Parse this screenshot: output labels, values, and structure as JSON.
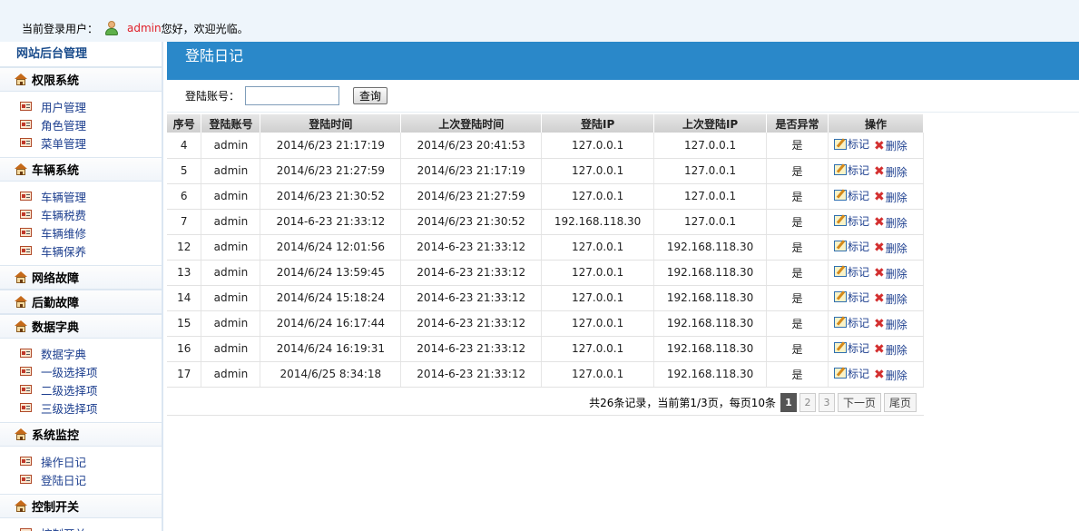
{
  "topbar": {
    "prefix": "当前登录用户：",
    "username": "admin",
    "greeting": "您好，欢迎光临。"
  },
  "sidebar": {
    "title": "网站后台管理",
    "groups": [
      {
        "label": "权限系统",
        "items": [
          "用户管理",
          "角色管理",
          "菜单管理"
        ]
      },
      {
        "label": "车辆系统",
        "items": [
          "车辆管理",
          "车辆税费",
          "车辆维修",
          "车辆保养"
        ]
      },
      {
        "label": "网络故障",
        "items": []
      },
      {
        "label": "后勤故障",
        "items": []
      },
      {
        "label": "数据字典",
        "items": [
          "数据字典",
          "一级选择项",
          "二级选择项",
          "三级选择项"
        ]
      },
      {
        "label": "系统监控",
        "items": [
          "操作日记",
          "登陆日记"
        ]
      },
      {
        "label": "控制开关",
        "items": [
          "控制开关"
        ]
      }
    ]
  },
  "main": {
    "title": "登陆日记",
    "search": {
      "label": "登陆账号：",
      "value": "",
      "button": "查询"
    },
    "table": {
      "headers": [
        "序号",
        "登陆账号",
        "登陆时间",
        "上次登陆时间",
        "登陆IP",
        "上次登陆IP",
        "是否异常",
        "操作"
      ],
      "rows": [
        [
          "4",
          "admin",
          "2014/6/23 21:17:19",
          "2014/6/23 20:41:53",
          "127.0.0.1",
          "127.0.0.1",
          "是"
        ],
        [
          "5",
          "admin",
          "2014/6/23 21:27:59",
          "2014/6/23 21:17:19",
          "127.0.0.1",
          "127.0.0.1",
          "是"
        ],
        [
          "6",
          "admin",
          "2014/6/23 21:30:52",
          "2014/6/23 21:27:59",
          "127.0.0.1",
          "127.0.0.1",
          "是"
        ],
        [
          "7",
          "admin",
          "2014-6-23 21:33:12",
          "2014/6/23 21:30:52",
          "192.168.118.30",
          "127.0.0.1",
          "是"
        ],
        [
          "12",
          "admin",
          "2014/6/24 12:01:56",
          "2014-6-23 21:33:12",
          "127.0.0.1",
          "192.168.118.30",
          "是"
        ],
        [
          "13",
          "admin",
          "2014/6/24 13:59:45",
          "2014-6-23 21:33:12",
          "127.0.0.1",
          "192.168.118.30",
          "是"
        ],
        [
          "14",
          "admin",
          "2014/6/24 15:18:24",
          "2014-6-23 21:33:12",
          "127.0.0.1",
          "192.168.118.30",
          "是"
        ],
        [
          "15",
          "admin",
          "2014/6/24 16:17:44",
          "2014-6-23 21:33:12",
          "127.0.0.1",
          "192.168.118.30",
          "是"
        ],
        [
          "16",
          "admin",
          "2014/6/24 16:19:31",
          "2014-6-23 21:33:12",
          "127.0.0.1",
          "192.168.118.30",
          "是"
        ],
        [
          "17",
          "admin",
          "2014/6/25 8:34:18",
          "2014-6-23 21:33:12",
          "127.0.0.1",
          "192.168.118.30",
          "是"
        ]
      ],
      "actions": {
        "mark": "标记",
        "delete": "删除"
      }
    },
    "pager": {
      "summary": "共26条记录，当前第1/3页，每页10条",
      "pages": [
        "1",
        "2",
        "3"
      ],
      "current_page": "1",
      "next": "下一页",
      "last": "尾页"
    }
  },
  "colors": {
    "header_blue": "#2a88c9",
    "admin_red": "#e0202a",
    "link_blue": "#1d3f8f"
  }
}
